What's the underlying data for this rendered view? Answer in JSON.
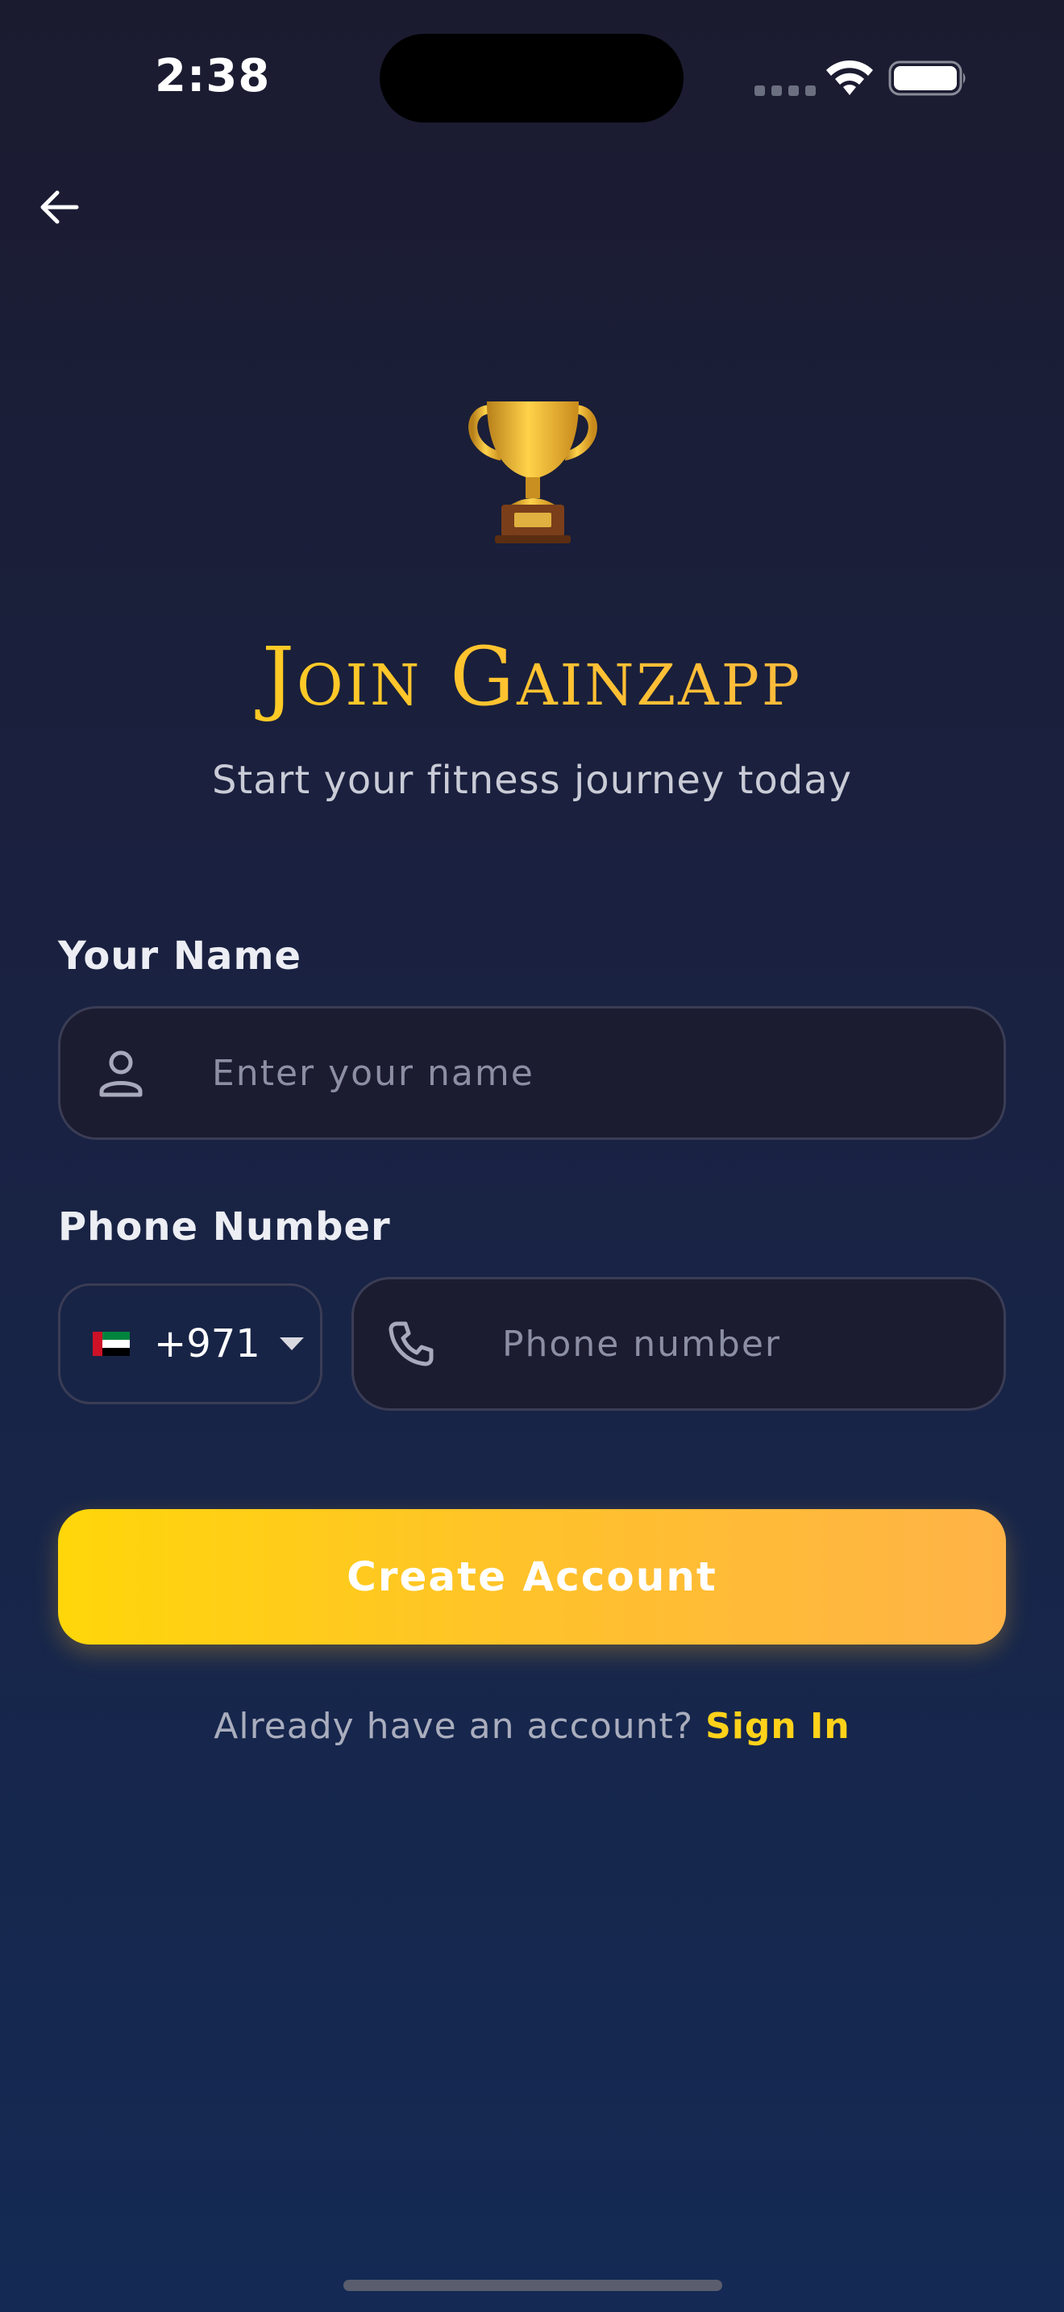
{
  "status_bar": {
    "time": "2:38"
  },
  "header": {
    "back_icon": "arrow-left-icon"
  },
  "hero": {
    "icon": "trophy-icon",
    "title": "Join Gainzapp",
    "subtitle": "Start your fitness journey today"
  },
  "form": {
    "name": {
      "label": "Your Name",
      "placeholder": "Enter your name",
      "value": "",
      "icon": "user-icon"
    },
    "phone": {
      "label": "Phone Number",
      "country_flag": "uae-flag-icon",
      "country_code": "+971",
      "placeholder": "Phone number",
      "value": "",
      "icon": "phone-icon"
    },
    "submit_label": "Create Account"
  },
  "footer": {
    "prompt": "Already have an account?",
    "link": "Sign In"
  },
  "colors": {
    "accent": "#ffd21a",
    "accent_end": "#ffb347",
    "background_top": "#1b1b30",
    "background_bottom": "#142a54",
    "input_bg": "#1c1c30",
    "input_border": "#3a3d55"
  }
}
